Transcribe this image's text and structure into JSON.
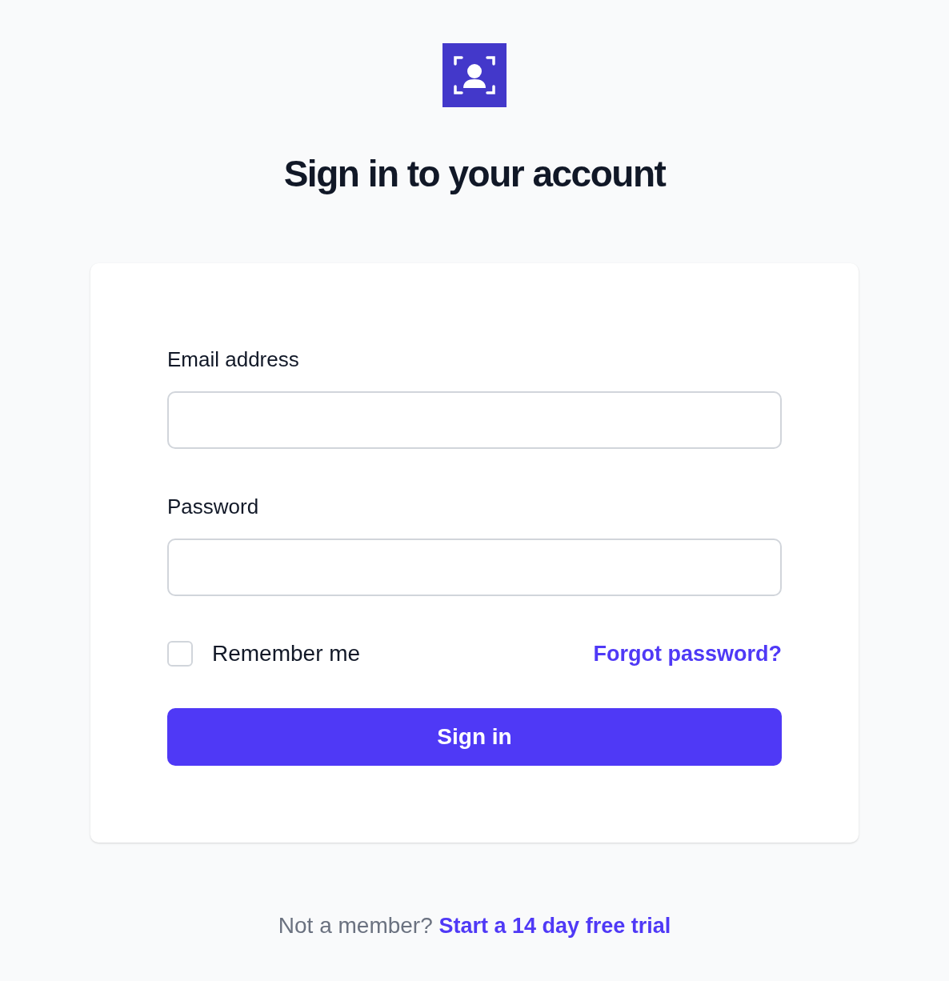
{
  "title": "Sign in to your account",
  "fields": [
    {
      "label": "Email address"
    },
    {
      "label": "Password"
    }
  ],
  "remember": {
    "label": "Remember me",
    "checked": false
  },
  "forgot_link": "Forgot password?",
  "submit_button": "Sign in",
  "footer": {
    "text": "Not a member?",
    "link": "Start a 14 day free trial"
  }
}
